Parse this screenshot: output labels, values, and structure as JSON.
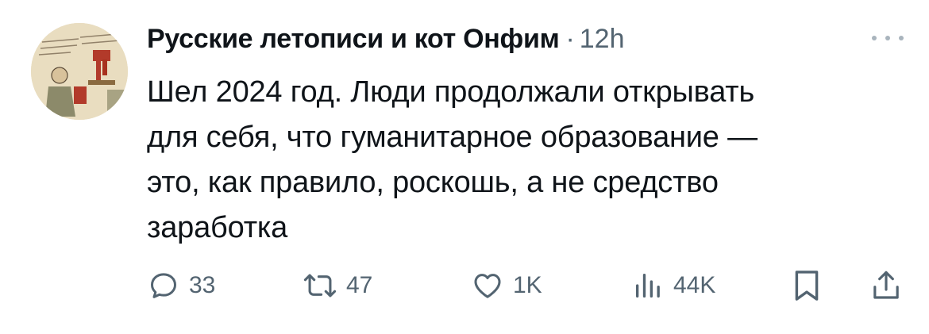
{
  "tweet": {
    "display_name": "Русские летописи и кот Онфим",
    "separator": "·",
    "time": "12h",
    "text": "Шел 2024 год. Люди продолжали открывать\nдля себя, что гуманитарное образование —\nэто, как правило, роскошь, а не средство\nзаработка",
    "more_icon": "ellipsis-icon"
  },
  "actions": {
    "reply": {
      "icon": "reply-icon",
      "count": "33"
    },
    "retweet": {
      "icon": "retweet-icon",
      "count": "47"
    },
    "like": {
      "icon": "heart-icon",
      "count": "1K"
    },
    "views": {
      "icon": "views-icon",
      "count": "44K"
    },
    "bookmark": {
      "icon": "bookmark-icon"
    },
    "share": {
      "icon": "share-icon"
    }
  },
  "colors": {
    "text": "#0f1419",
    "secondary": "#536471"
  }
}
